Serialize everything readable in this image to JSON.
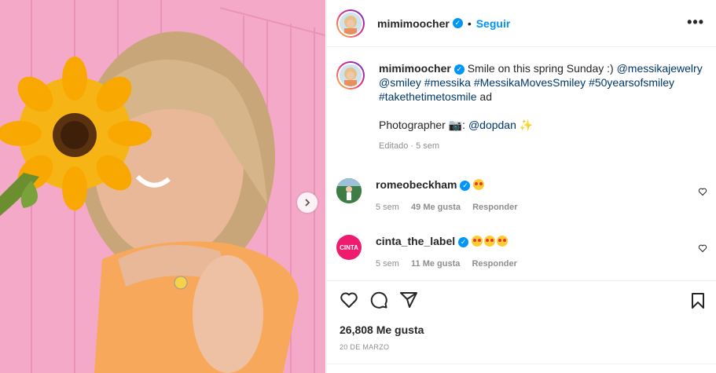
{
  "post": {
    "author": "mimimoocher",
    "follow_label": "Seguir",
    "dot": "•",
    "more_label": "•••",
    "caption": {
      "author": "mimimoocher",
      "text_1": "Smile on this spring Sunday :)",
      "mention_1": "@messikajewelry",
      "mention_2": "@smiley",
      "tag_1": "#messika",
      "tag_2": "#MessikaMovesSmiley",
      "tag_3": "#50yearsofsmiley",
      "tag_4": "#takethetimetosmile",
      "ad": "ad",
      "photographer_label": "Photographer",
      "photographer_colon": ":",
      "photographer_mention": "@dopdan",
      "meta": "Editado · 5 sem"
    },
    "comments": [
      {
        "author": "romeobeckham",
        "time": "5 sem",
        "likes": "49 Me gusta",
        "reply": "Responder"
      },
      {
        "author": "cinta_the_label",
        "avatar_text": "CINTA",
        "time": "5 sem",
        "likes": "11 Me gusta",
        "reply": "Responder"
      }
    ],
    "like_count": "26,808 Me gusta",
    "date": "20 DE MARZO"
  },
  "colors": {
    "accent": "#0095f6",
    "link": "#00376b",
    "muted": "#8e8e8e"
  },
  "icons": {
    "heart": "heart-icon",
    "comment": "comment-icon",
    "share": "paper-plane-icon",
    "save": "bookmark-icon",
    "verified": "verified-badge-icon",
    "next": "chevron-right-icon",
    "camera": "camera-emoji",
    "sparkle": "sparkles-emoji",
    "heart_eyes": "heart-eyes-emoji"
  }
}
